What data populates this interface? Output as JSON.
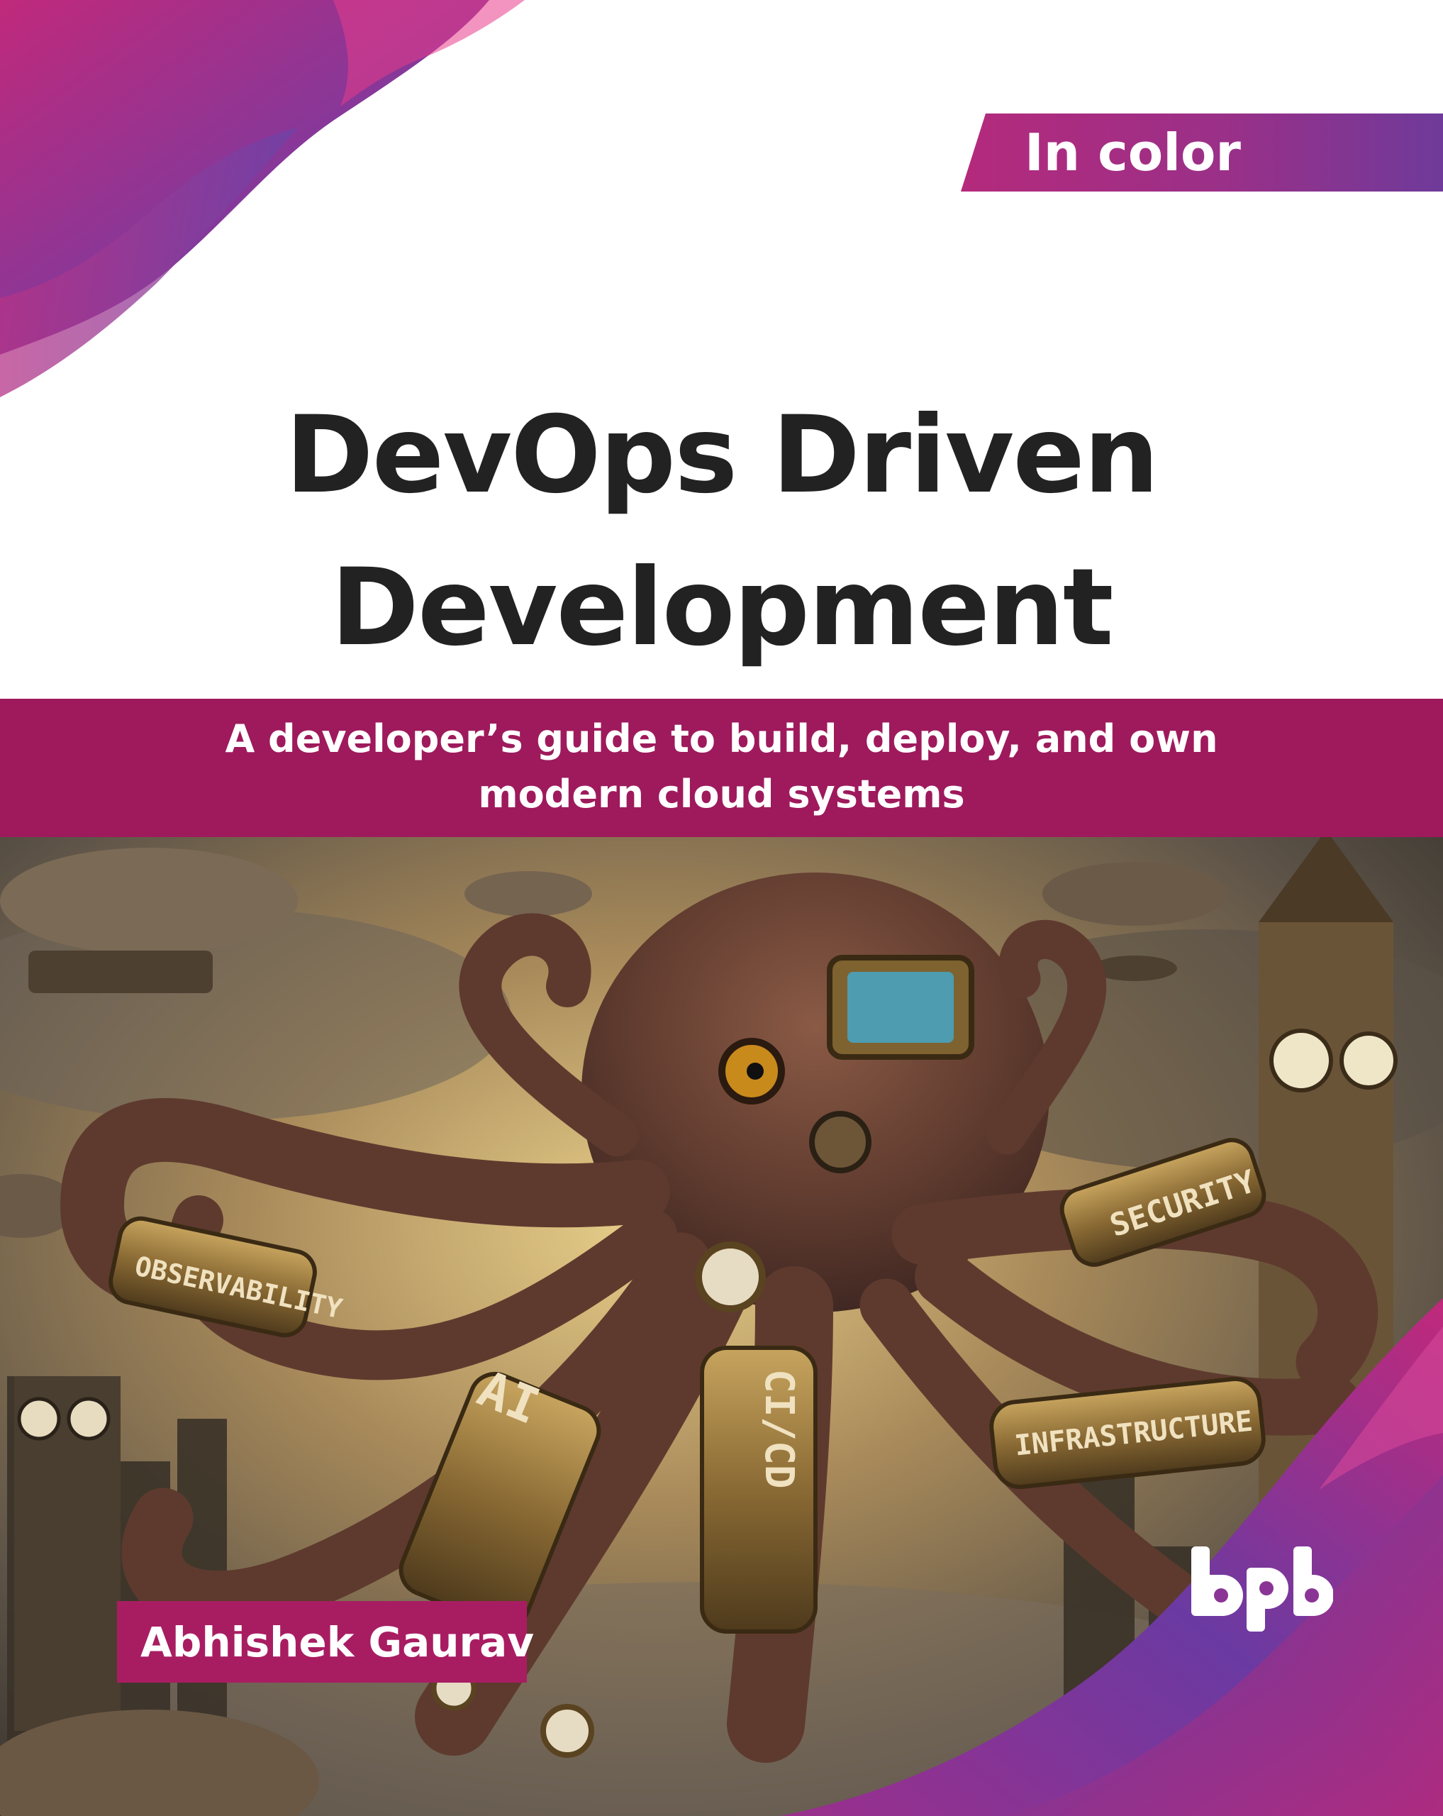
{
  "badge": {
    "label": "In color"
  },
  "title": {
    "line1": "DevOps Driven",
    "line2": "Development"
  },
  "subtitle": {
    "line1": "A developer’s guide to build, deploy, and own",
    "line2": "modern cloud systems"
  },
  "illustration": {
    "labels": {
      "observability": "OBSERVABILITY",
      "ai": "AI",
      "cicd": "CI/CD",
      "security": "SECURITY",
      "infrastructure": "INFRASTRUCTURE"
    }
  },
  "author": {
    "name": "Abhishek Gaurav"
  },
  "publisher": {
    "logo_text": "bpb"
  },
  "colors": {
    "magenta": "#9e1a5c",
    "purple": "#6f3a9a",
    "pink": "#b42a7c",
    "title_text": "#222222"
  }
}
